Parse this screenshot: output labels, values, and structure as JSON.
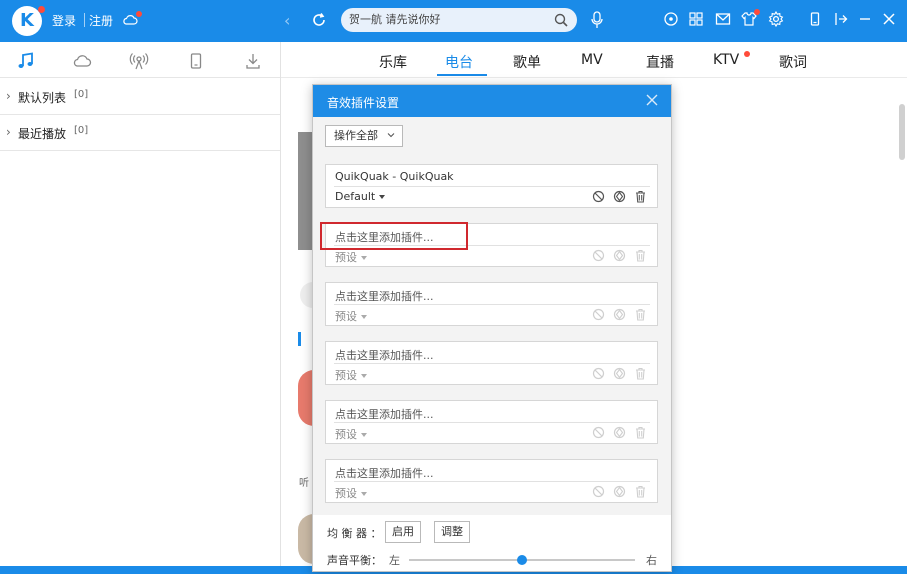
{
  "topbar": {
    "logo": "K",
    "login": "登录",
    "register": "注册",
    "search_value": "贺一航 请先说你好",
    "accent": "#1a8be8"
  },
  "sidebar": {
    "tab_icons": [
      "music-note-icon",
      "cloud-icon",
      "radio-icon",
      "phone-icon",
      "download-icon"
    ],
    "items": [
      {
        "label": "默认列表",
        "count": "[0]"
      },
      {
        "label": "最近播放",
        "count": "[0]"
      }
    ]
  },
  "main": {
    "tabs": [
      "乐库",
      "电台",
      "歌单",
      "MV",
      "直播",
      "KTV",
      "歌词"
    ],
    "active_tab": "电台",
    "bg_text": "听"
  },
  "dialog": {
    "title": "音效插件设置",
    "operate_all": "操作全部",
    "slots": [
      {
        "name": "QuikQuak - QuikQuak",
        "preset": "Default",
        "active": true
      },
      {
        "name": "点击这里添加插件...",
        "preset": "预设",
        "active": false
      },
      {
        "name": "点击这里添加插件...",
        "preset": "预设",
        "active": false
      },
      {
        "name": "点击这里添加插件...",
        "preset": "预设",
        "active": false
      },
      {
        "name": "点击这里添加插件...",
        "preset": "预设",
        "active": false
      },
      {
        "name": "点击这里添加插件...",
        "preset": "预设",
        "active": false
      }
    ],
    "equalizer_label": "均 衡 器 ：",
    "enable_label": "启用",
    "adjust_label": "调整",
    "balance_label": "声音平衡：",
    "balance_left": "左",
    "balance_right": "右",
    "balance_value": 0.5
  }
}
